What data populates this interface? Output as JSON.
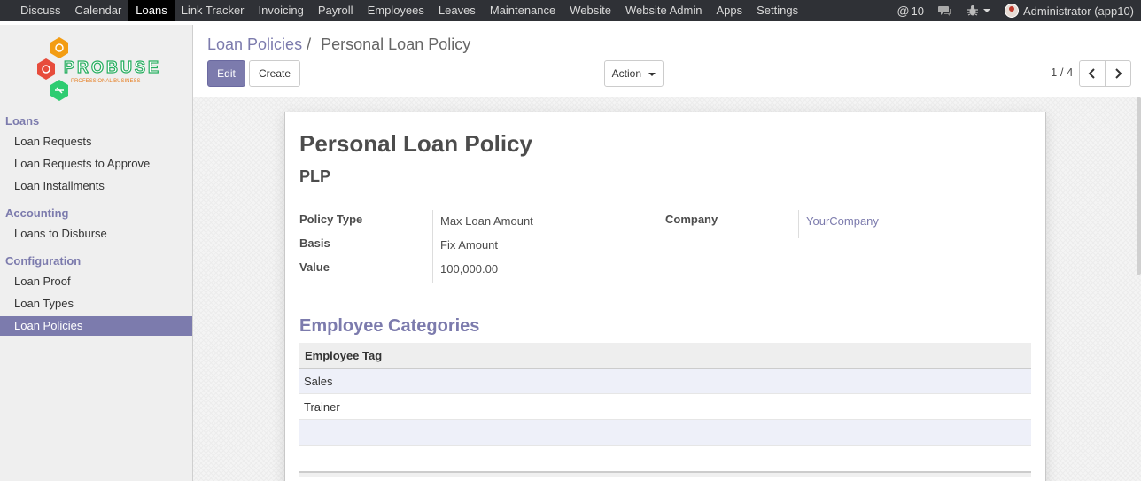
{
  "topbar": {
    "menu": [
      "Discuss",
      "Calendar",
      "Loans",
      "Link Tracker",
      "Invoicing",
      "Payroll",
      "Employees",
      "Leaves",
      "Maintenance",
      "Website",
      "Website Admin",
      "Apps",
      "Settings"
    ],
    "active_menu": "Loans",
    "messages_count": "10",
    "user_label": "Administrator (app10)"
  },
  "sidebar": {
    "logo_text": "PROBUSE",
    "logo_subtext": "PROFESSIONAL BUSINESS",
    "sections": [
      {
        "title": "Loans",
        "items": [
          "Loan Requests",
          "Loan Requests to Approve",
          "Loan Installments"
        ]
      },
      {
        "title": "Accounting",
        "items": [
          "Loans to Disburse"
        ]
      },
      {
        "title": "Configuration",
        "items": [
          "Loan Proof",
          "Loan Types",
          "Loan Policies"
        ]
      }
    ],
    "active_item": "Loan Policies"
  },
  "breadcrumb": {
    "parent": "Loan Policies",
    "separator": "/",
    "current": "Personal Loan Policy"
  },
  "buttons": {
    "edit": "Edit",
    "create": "Create",
    "action": "Action"
  },
  "pager": {
    "value": "1 / 4"
  },
  "record": {
    "title": "Personal Loan Policy",
    "code": "PLP",
    "fields": {
      "policy_type": {
        "label": "Policy Type",
        "value": "Max Loan Amount"
      },
      "basis": {
        "label": "Basis",
        "value": "Fix Amount"
      },
      "value": {
        "label": "Value",
        "value": "100,000.00"
      },
      "company": {
        "label": "Company",
        "value": "YourCompany"
      }
    },
    "categories_title": "Employee Categories",
    "categories_header": "Employee Tag",
    "categories": [
      "Sales",
      "Trainer"
    ]
  },
  "colors": {
    "brand": "#7c7bad",
    "topbar": "#2f3136",
    "sidebar": "#efefef"
  }
}
